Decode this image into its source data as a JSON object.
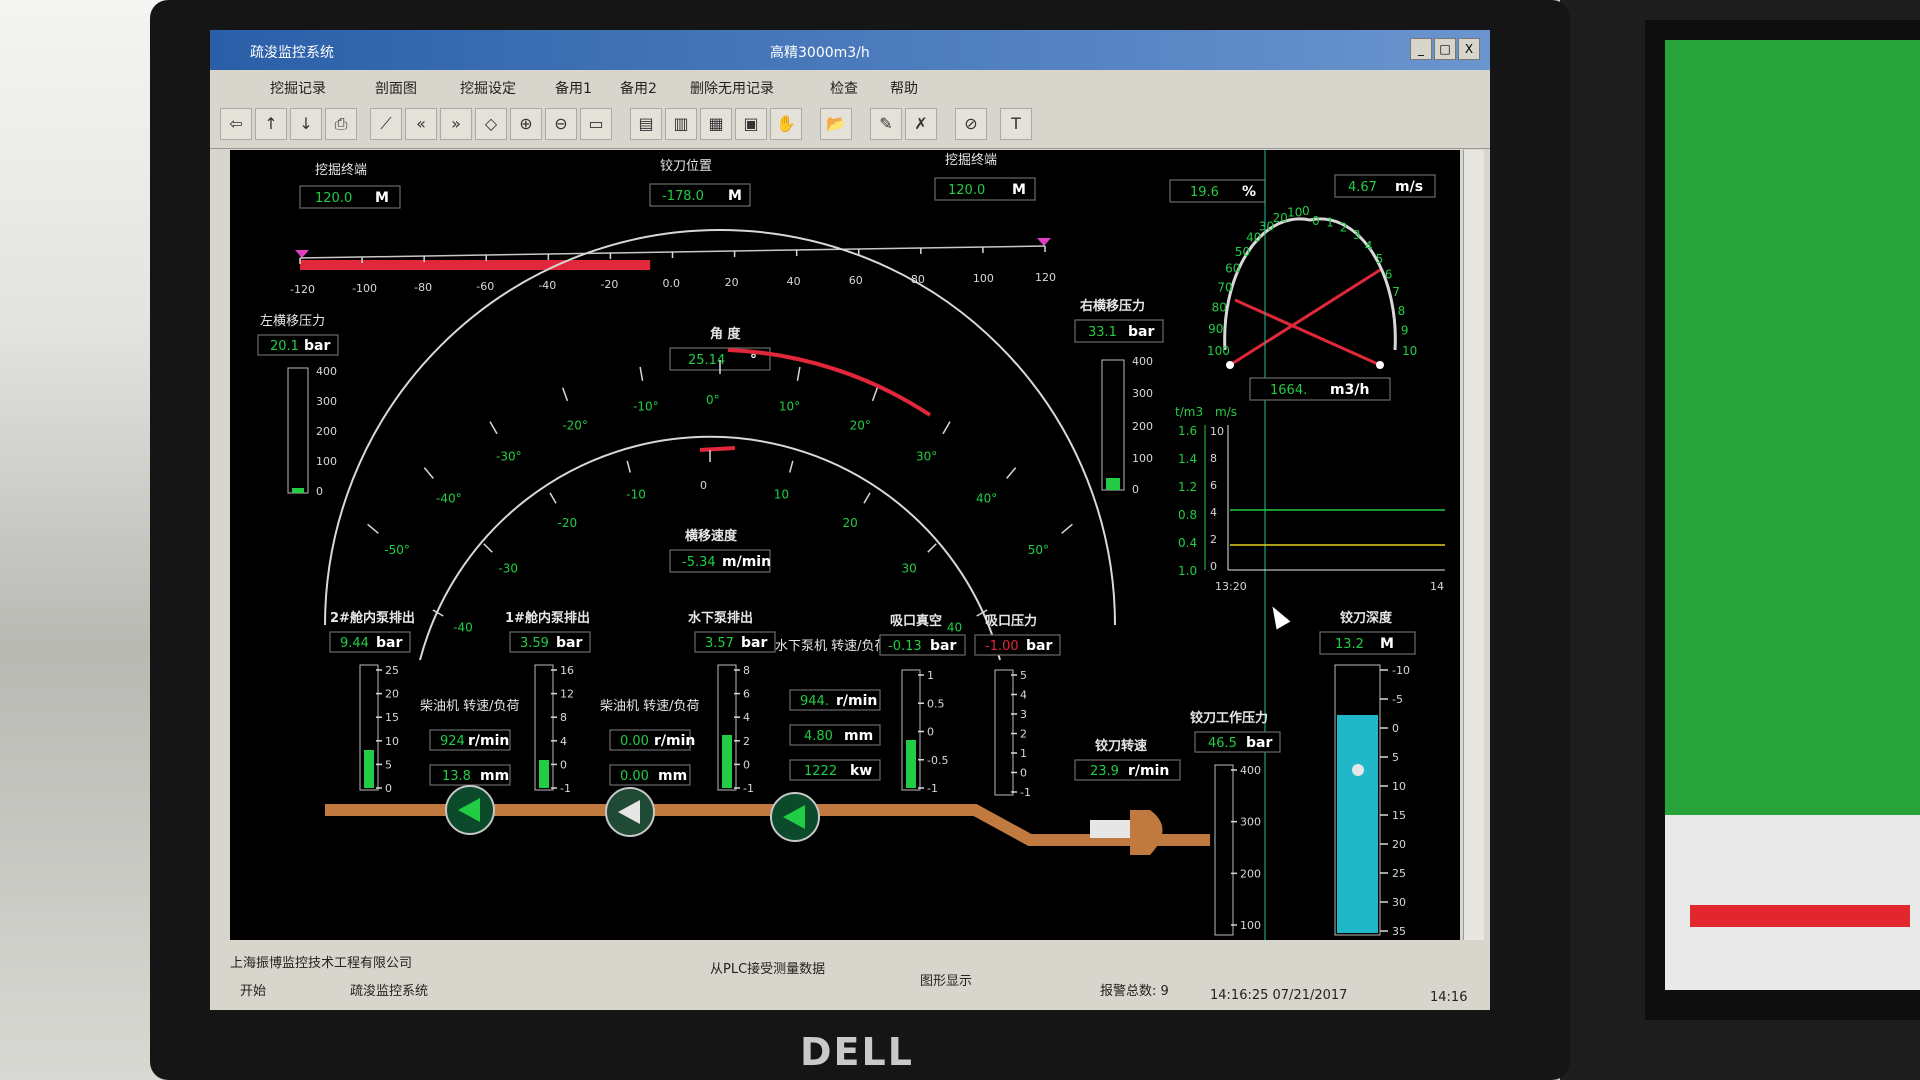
{
  "window": {
    "title": "疏浚监控系统",
    "center_title": "高精3000m3/h",
    "btn_min": "_",
    "btn_max": "□",
    "btn_close": "X"
  },
  "menu": [
    "挖掘记录",
    "剖面图",
    "挖掘设定",
    "备用1",
    "备用2",
    "删除无用记录",
    "检查",
    "帮助"
  ],
  "toolbar": [
    "⇦",
    "↑",
    "↓",
    "⎙",
    "⟋",
    "«",
    "»",
    "◇",
    "⊕",
    "⊖",
    "▭",
    "▤",
    "▥",
    "▦",
    "▣",
    "✋",
    "📂",
    "✎",
    "✗",
    "⊘",
    "T"
  ],
  "panel": {
    "dig_end_left_label": "挖掘终端",
    "dig_end_left_value": "120.0",
    "dig_end_left_unit": "M",
    "cutter_pos_label": "铰刀位置",
    "cutter_pos_value": "-178.0",
    "cutter_pos_unit": "M",
    "dig_end_right_label": "挖掘终端",
    "dig_end_right_value": "120.0",
    "dig_end_right_unit": "M",
    "position_ticks": [
      "-120",
      "-100",
      "-80",
      "-60",
      "-40",
      "-20",
      "0.0",
      "20",
      "40",
      "60",
      "80",
      "100",
      "120"
    ],
    "position_fill_fraction": 0.47,
    "angle_label": "角 度",
    "angle_value": "25.14",
    "angle_unit": "°",
    "angle_ticks": [
      "-50°",
      "-40°",
      "-30°",
      "-20°",
      "-10°",
      "0°",
      "10°",
      "20°",
      "30°",
      "40°",
      "50°"
    ],
    "swing_speed_label": "横移速度",
    "swing_speed_value": "-5.34",
    "swing_speed_unit": "m/min",
    "swing_ticks": [
      "-40",
      "-30",
      "-20",
      "-10",
      "0",
      "10",
      "20",
      "30",
      "40"
    ],
    "left_swing_label": "左横移压力",
    "left_swing_value": "20.1",
    "left_swing_unit": "bar",
    "left_swing_ticks": [
      "400",
      "300",
      "200",
      "100",
      "0"
    ],
    "right_swing_label": "右横移压力",
    "right_swing_value": "33.1",
    "right_swing_unit": "bar",
    "right_swing_ticks": [
      "400",
      "300",
      "200",
      "100",
      "0"
    ],
    "percent_value": "19.6",
    "percent_unit": "%",
    "speed_value": "4.67",
    "speed_unit": "m/s",
    "gauge_left_ticks": [
      "100",
      "90",
      "80",
      "70",
      "60",
      "50",
      "40",
      "30",
      "20",
      "10",
      "0"
    ],
    "gauge_right_ticks": [
      "10",
      "9",
      "8",
      "7",
      "6",
      "5",
      "4",
      "3",
      "2",
      "1",
      "0"
    ],
    "flow_value": "1664.",
    "flow_unit": "m3/h",
    "trend_y1_unit": "t/m3",
    "trend_y2_unit": "m/s",
    "trend_y1_ticks": [
      "1.6",
      "1.4",
      "1.2",
      "0.8",
      "0.4",
      "1.0"
    ],
    "trend_y2_ticks": [
      "10",
      "8",
      "6",
      "4",
      "2",
      "0"
    ],
    "trend_x_start": "13:20",
    "trend_x_end": "14",
    "cutter_depth_label": "铰刀深度",
    "cutter_depth_value": "13.2",
    "cutter_depth_unit": "M",
    "cutter_depth_ticks": [
      "-10",
      "-5",
      "0",
      "5",
      "10",
      "15",
      "20",
      "25",
      "30",
      "35"
    ],
    "pump2_label": "2#舱内泵排出",
    "pump2_value": "9.44",
    "pump2_unit": "bar",
    "pump2_ticks": [
      "25",
      "20",
      "15",
      "10",
      "5",
      "0"
    ],
    "diesel1_label": "柴油机\n转速/负荷",
    "diesel1_rpm": "924",
    "diesel1_rpm_unit": "r/min",
    "diesel1_mm": "13.8",
    "diesel1_mm_unit": "mm",
    "pump1_label": "1#舱内泵排出",
    "pump1_value": "3.59",
    "pump1_unit": "bar",
    "pump1_ticks": [
      "16",
      "12",
      "8",
      "4",
      "0",
      "-1"
    ],
    "diesel2_label": "柴油机\n转速/负荷",
    "diesel2_rpm": "0.00",
    "diesel2_rpm_unit": "r/min",
    "diesel2_mm": "0.00",
    "diesel2_mm_unit": "mm",
    "uw_pump_label": "水下泵排出",
    "uw_pump_value": "3.57",
    "uw_pump_unit": "bar",
    "uw_pump_ticks": [
      "8",
      "6",
      "4",
      "2",
      "0",
      "-1"
    ],
    "uw_motor_label": "水下泵机\n转速/负荷/功率",
    "uw_motor_rpm": "944.",
    "uw_motor_rpm_unit": "r/min",
    "uw_motor_mm": "4.80",
    "uw_motor_mm_unit": "mm",
    "uw_motor_kw": "1222",
    "uw_motor_kw_unit": "kw",
    "suction_vac_label": "吸口真空",
    "suction_vac_value": "-0.13",
    "suction_vac_unit": "bar",
    "suction_vac_ticks": [
      "1",
      "0.5",
      "0",
      "-0.5",
      "-1"
    ],
    "suction_press_label": "吸口压力",
    "suction_press_value": "-1.00",
    "suction_press_unit": "bar",
    "suction_press_ticks": [
      "5",
      "4",
      "3",
      "2",
      "1",
      "0",
      "-1"
    ],
    "cutter_speed_label": "铰刀转速",
    "cutter_speed_value": "23.9",
    "cutter_speed_unit": "r/min",
    "cutter_press_label": "铰刀工作压力",
    "cutter_press_value": "46.5",
    "cutter_press_unit": "bar",
    "cutter_press_ticks": [
      "400",
      "300",
      "200",
      "100"
    ]
  },
  "status": {
    "company": "上海振博监控技术工程有限公司",
    "plc": "从PLC接受测量数据",
    "graph": "图形显示",
    "alarm": "报警总数: 9",
    "datetime": "14:16:25 07/21/2017",
    "start": "开始",
    "task": "疏浚监控系统",
    "clock": "14:16"
  },
  "brand": "DELL",
  "colors": {
    "bg": "#000000",
    "green_text": "#22cc44",
    "red_bar": "#e0283a",
    "cyan": "#20b8c8",
    "orange_pipe": "#c07a40"
  }
}
